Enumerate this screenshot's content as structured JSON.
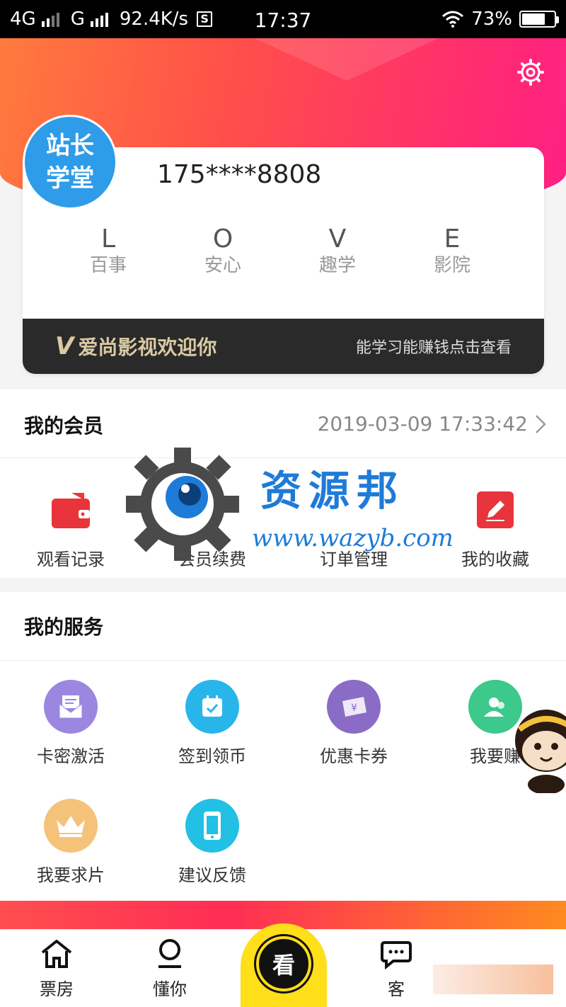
{
  "status_bar": {
    "network1": "4G",
    "network2": "G",
    "speed": "92.4K/s",
    "s_icon": "S",
    "time": "17:37",
    "battery_pct": "73%",
    "battery_level": 0.73
  },
  "profile": {
    "avatar_line1": "站长",
    "avatar_line2": "学堂",
    "phone": "175****8808",
    "love": [
      {
        "letter": "L",
        "word": "百事"
      },
      {
        "letter": "O",
        "word": "安心"
      },
      {
        "letter": "V",
        "word": "趣学"
      },
      {
        "letter": "E",
        "word": "影院"
      }
    ],
    "banner_logo": "V",
    "banner_slogan": "爱尚影视欢迎你",
    "banner_cta": "能学习能赚钱点击查看"
  },
  "member": {
    "title": "我的会员",
    "date": "2019-03-09 17:33:42",
    "items": [
      {
        "label": "观看记录",
        "icon": "wallet-icon"
      },
      {
        "label": "会员续费",
        "icon": "renew-icon"
      },
      {
        "label": "订单管理",
        "icon": "order-icon"
      },
      {
        "label": "我的收藏",
        "icon": "edit-icon"
      }
    ]
  },
  "watermark": {
    "text": "资源邦",
    "url": "www.wazyb.com"
  },
  "services": {
    "title": "我的服务",
    "items": [
      {
        "label": "卡密激活",
        "icon": "envelope-icon",
        "color": "#9b87e0"
      },
      {
        "label": "签到领币",
        "icon": "calendar-check-icon",
        "color": "#28b6ea"
      },
      {
        "label": "优惠卡券",
        "icon": "coupon-icon",
        "color": "#8a6cc6"
      },
      {
        "label": "我要赚",
        "icon": "user-add-icon",
        "color": "#3cc98b"
      },
      {
        "label": "我要求片",
        "icon": "crown-icon",
        "color": "#f5c27a"
      },
      {
        "label": "建议反馈",
        "icon": "phone-icon",
        "color": "#22c0e4"
      }
    ]
  },
  "tabbar": {
    "tabs": [
      {
        "label": "票房",
        "icon": "house-icon"
      },
      {
        "label": "懂你",
        "icon": "person-icon"
      },
      {
        "label": "看",
        "icon": "watch-icon"
      },
      {
        "label": "客",
        "icon": "chat-icon"
      }
    ]
  },
  "colors": {
    "accent": "#ff2d6f",
    "center_tab": "#ffde1a",
    "avatar": "#2e9ce8",
    "banner_bg": "#2a2a2a",
    "banner_text": "#d9c9a3"
  }
}
